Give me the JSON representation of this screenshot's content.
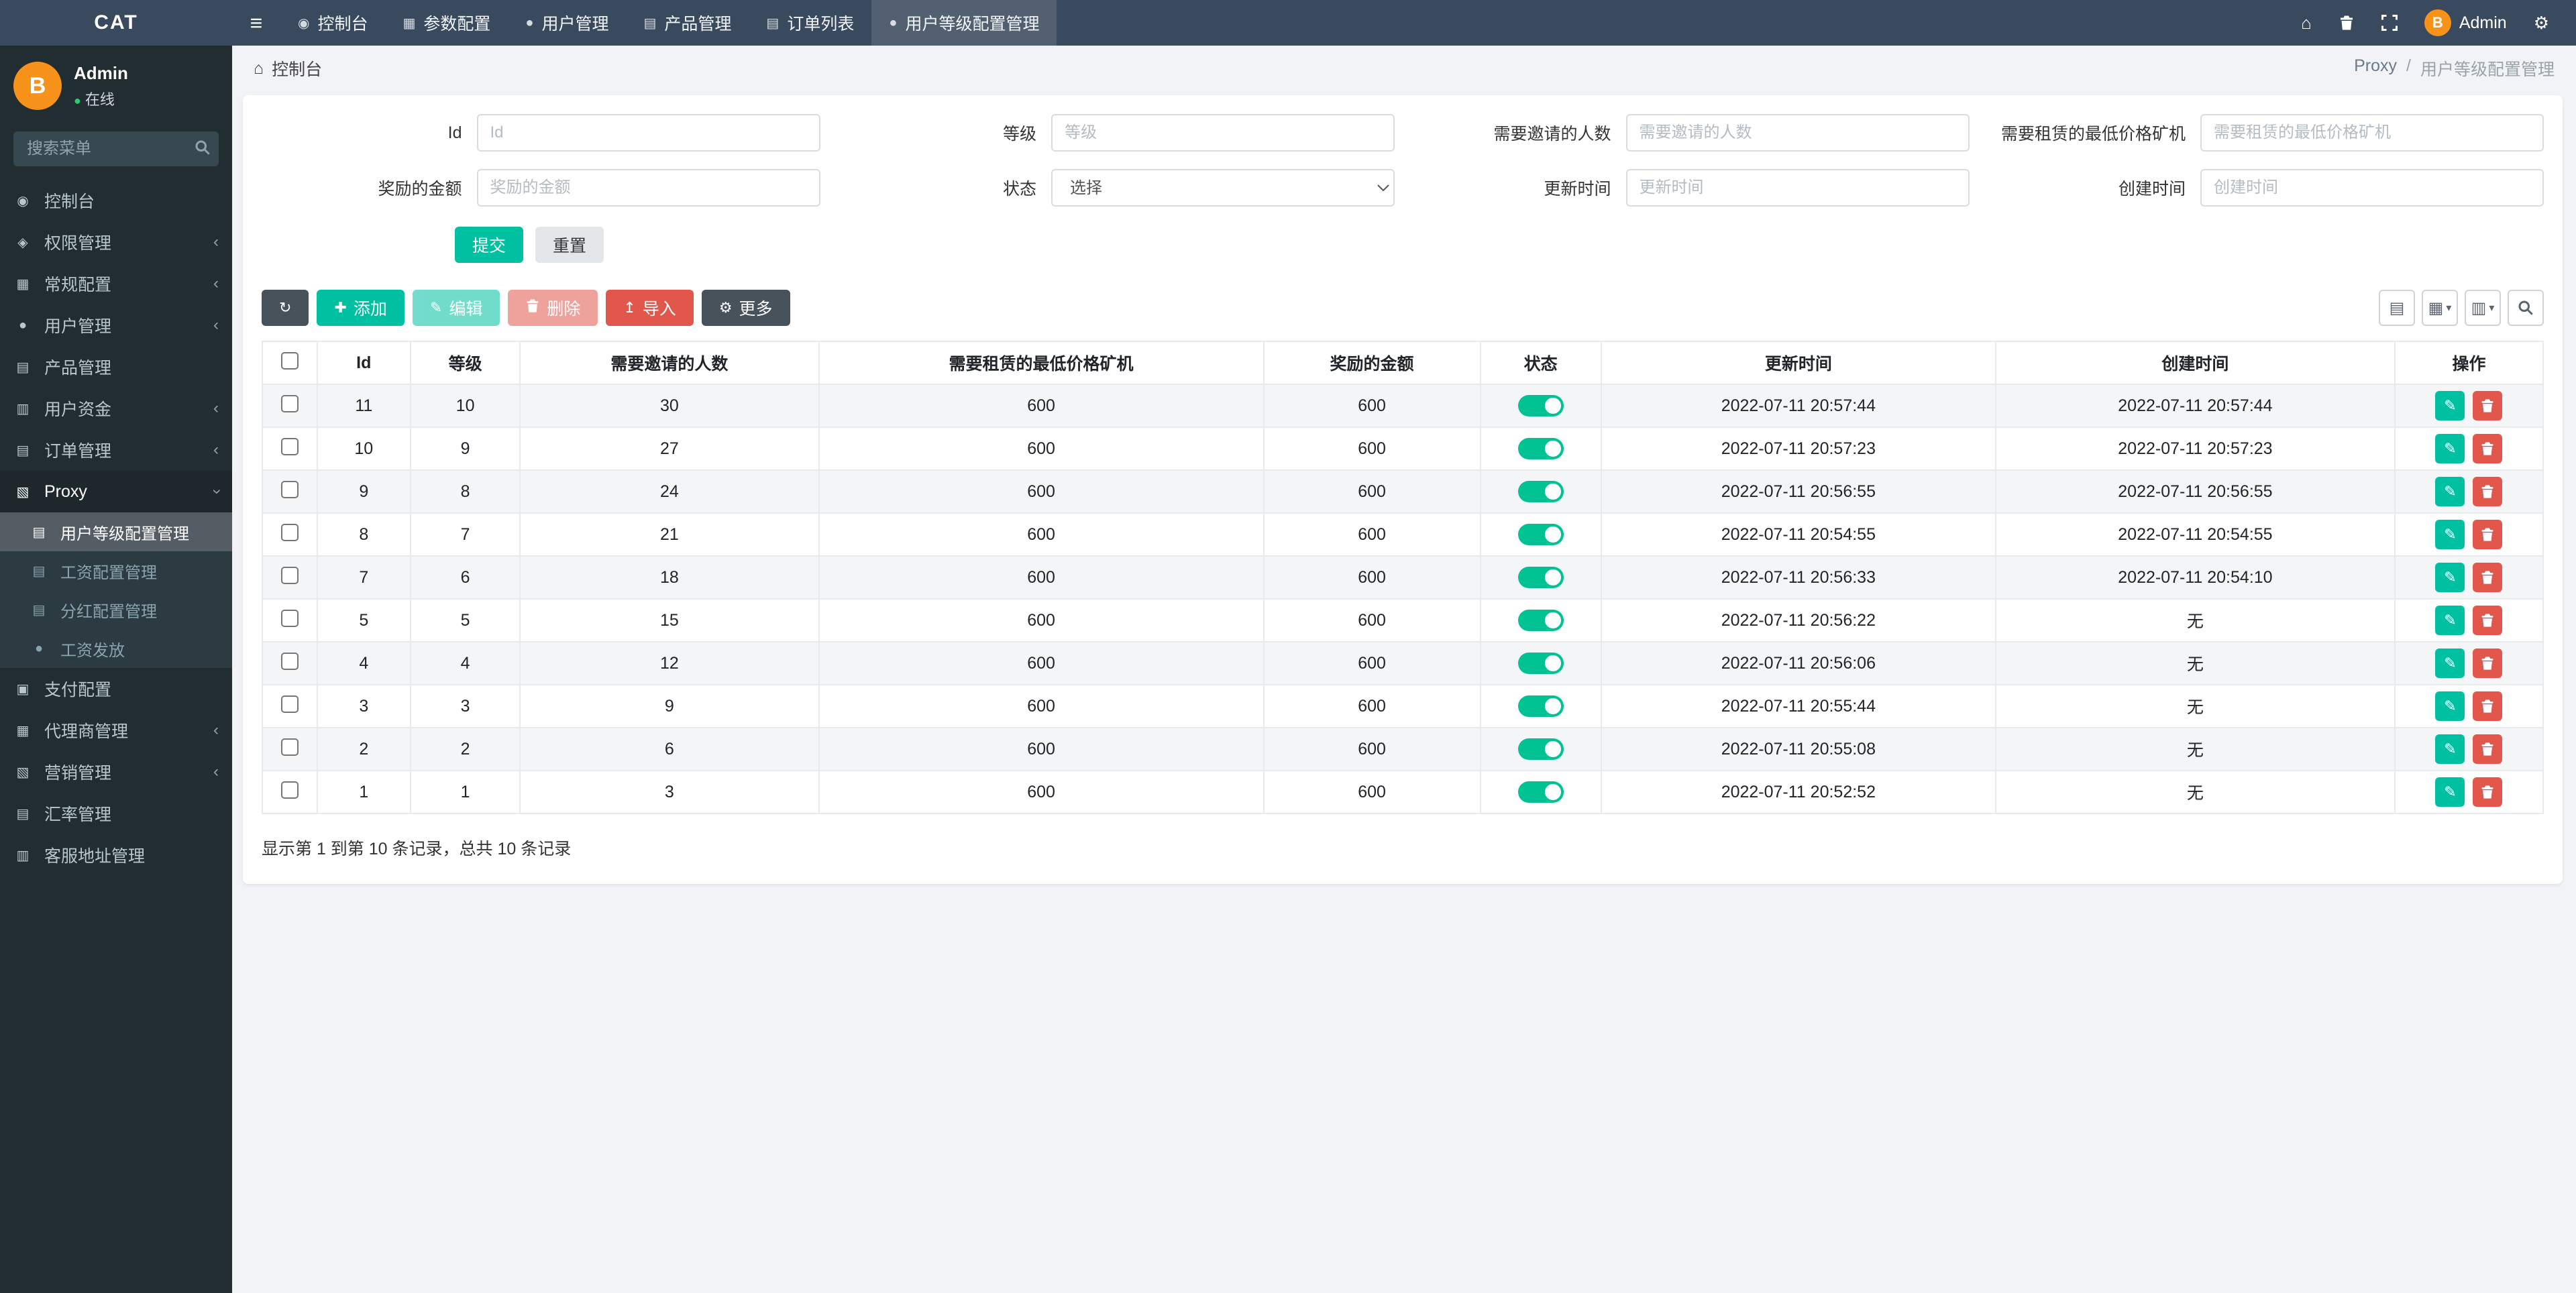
{
  "navbar": {
    "brand": "CAT",
    "items": [
      {
        "key": "console",
        "label": "控制台",
        "icon": "dashboard-icon"
      },
      {
        "key": "params",
        "label": "参数配置",
        "icon": "params-icon"
      },
      {
        "key": "users",
        "label": "用户管理",
        "icon": "user-icon"
      },
      {
        "key": "products",
        "label": "产品管理",
        "icon": "product-icon"
      },
      {
        "key": "orders",
        "label": "订单列表",
        "icon": "orders-icon"
      },
      {
        "key": "level-config",
        "label": "用户等级配置管理",
        "icon": "level-icon",
        "active": true
      }
    ],
    "user": "Admin"
  },
  "sidebar": {
    "user": {
      "name": "Admin",
      "status": "在线"
    },
    "search_placeholder": "搜索菜单",
    "items": [
      {
        "key": "console",
        "label": "控制台",
        "icon": "dashboard-icon"
      },
      {
        "key": "permissions",
        "label": "权限管理",
        "icon": "shield-icon",
        "chevron": true
      },
      {
        "key": "general-config",
        "label": "常规配置",
        "icon": "settings-icon",
        "chevron": true
      },
      {
        "key": "user-mgmt",
        "label": "用户管理",
        "icon": "user-icon",
        "chevron": true
      },
      {
        "key": "product-mgmt",
        "label": "产品管理",
        "icon": "product-icon"
      },
      {
        "key": "user-funds",
        "label": "用户资金",
        "icon": "funds-icon",
        "chevron": true
      },
      {
        "key": "order-mgmt",
        "label": "订单管理",
        "icon": "orders-icon",
        "chevron": true
      },
      {
        "key": "proxy",
        "label": "Proxy",
        "icon": "proxy-icon",
        "expanded": true,
        "active": true,
        "children": [
          {
            "key": "level-config",
            "label": "用户等级配置管理",
            "icon": "list-icon",
            "active": true
          },
          {
            "key": "salary-config",
            "label": "工资配置管理",
            "icon": "list-icon"
          },
          {
            "key": "dividend-config",
            "label": "分红配置管理",
            "icon": "list-icon"
          },
          {
            "key": "salary-payout",
            "label": "工资发放",
            "icon": "user-icon"
          }
        ]
      },
      {
        "key": "payment-config",
        "label": "支付配置",
        "icon": "payment-icon"
      },
      {
        "key": "agent-mgmt",
        "label": "代理商管理",
        "icon": "agent-icon",
        "chevron": true
      },
      {
        "key": "marketing-mgmt",
        "label": "营销管理",
        "icon": "marketing-icon",
        "chevron": true
      },
      {
        "key": "rate-mgmt",
        "label": "汇率管理",
        "icon": "rate-icon"
      },
      {
        "key": "service-addr",
        "label": "客服地址管理",
        "icon": "service-icon"
      }
    ]
  },
  "breadcrumb": {
    "home": "控制台",
    "section": "Proxy",
    "separator": "/",
    "current": "用户等级配置管理"
  },
  "filters": {
    "fields": [
      {
        "label": "Id",
        "placeholder": "Id"
      },
      {
        "label": "等级",
        "placeholder": "等级"
      },
      {
        "label": "需要邀请的人数",
        "placeholder": "需要邀请的人数"
      },
      {
        "label": "需要租赁的最低价格矿机",
        "placeholder": "需要租赁的最低价格矿机"
      },
      {
        "label": "奖励的金额",
        "placeholder": "奖励的金额"
      },
      {
        "label": "状态",
        "value": "选择"
      },
      {
        "label": "更新时间",
        "placeholder": "更新时间"
      },
      {
        "label": "创建时间",
        "placeholder": "创建时间"
      }
    ],
    "submit": "提交",
    "reset": "重置"
  },
  "toolbar": {
    "add": "添加",
    "edit": "编辑",
    "delete": "删除",
    "import": "导入",
    "more": "更多"
  },
  "table": {
    "headers": [
      "Id",
      "等级",
      "需要邀请的人数",
      "需要租赁的最低价格矿机",
      "奖励的金额",
      "状态",
      "更新时间",
      "创建时间",
      "操作"
    ],
    "rows": [
      {
        "id": 11,
        "level": 10,
        "invites": 30,
        "min_price": 600,
        "reward": 600,
        "status": "on",
        "updated": "2022-07-11 20:57:44",
        "created": "2022-07-11 20:57:44"
      },
      {
        "id": 10,
        "level": 9,
        "invites": 27,
        "min_price": 600,
        "reward": 600,
        "status": "on",
        "updated": "2022-07-11 20:57:23",
        "created": "2022-07-11 20:57:23"
      },
      {
        "id": 9,
        "level": 8,
        "invites": 24,
        "min_price": 600,
        "reward": 600,
        "status": "on",
        "updated": "2022-07-11 20:56:55",
        "created": "2022-07-11 20:56:55"
      },
      {
        "id": 8,
        "level": 7,
        "invites": 21,
        "min_price": 600,
        "reward": 600,
        "status": "on",
        "updated": "2022-07-11 20:54:55",
        "created": "2022-07-11 20:54:55"
      },
      {
        "id": 7,
        "level": 6,
        "invites": 18,
        "min_price": 600,
        "reward": 600,
        "status": "on",
        "updated": "2022-07-11 20:56:33",
        "created": "2022-07-11 20:54:10"
      },
      {
        "id": 5,
        "level": 5,
        "invites": 15,
        "min_price": 600,
        "reward": 600,
        "status": "on",
        "updated": "2022-07-11 20:56:22",
        "created": "无"
      },
      {
        "id": 4,
        "level": 4,
        "invites": 12,
        "min_price": 600,
        "reward": 600,
        "status": "on",
        "updated": "2022-07-11 20:56:06",
        "created": "无"
      },
      {
        "id": 3,
        "level": 3,
        "invites": 9,
        "min_price": 600,
        "reward": 600,
        "status": "on",
        "updated": "2022-07-11 20:55:44",
        "created": "无"
      },
      {
        "id": 2,
        "level": 2,
        "invites": 6,
        "min_price": 600,
        "reward": 600,
        "status": "on",
        "updated": "2022-07-11 20:55:08",
        "created": "无"
      },
      {
        "id": 1,
        "level": 1,
        "invites": 3,
        "min_price": 600,
        "reward": 600,
        "status": "on",
        "updated": "2022-07-11 20:52:52",
        "created": "无"
      }
    ]
  },
  "summary": "显示第 1 到第 10 条记录，总共 10 条记录"
}
